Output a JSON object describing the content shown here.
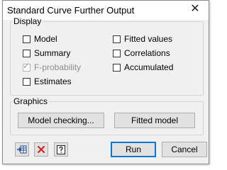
{
  "window": {
    "title": "Standard Curve Further Output",
    "close_glyph": "✕"
  },
  "display": {
    "legend": "Display",
    "options": [
      {
        "label": "Model",
        "checked": false,
        "disabled": false
      },
      {
        "label": "Summary",
        "checked": false,
        "disabled": false
      },
      {
        "label": "F-probability",
        "checked": true,
        "disabled": true
      },
      {
        "label": "Estimates",
        "checked": false,
        "disabled": false
      },
      {
        "label": "Fitted values",
        "checked": false,
        "disabled": false
      },
      {
        "label": "Correlations",
        "checked": false,
        "disabled": false
      },
      {
        "label": "Accumulated",
        "checked": false,
        "disabled": false
      }
    ]
  },
  "graphics": {
    "legend": "Graphics",
    "model_checking_label": "Model checking...",
    "fitted_model_label": "Fitted model"
  },
  "footer": {
    "run_label": "Run",
    "cancel_label": "Cancel",
    "icons": [
      "export-to-spreadsheet-icon",
      "clear-icon",
      "help-icon"
    ]
  },
  "colors": {
    "clear_icon": "#d32020",
    "default_button_border": "#0078d7"
  }
}
